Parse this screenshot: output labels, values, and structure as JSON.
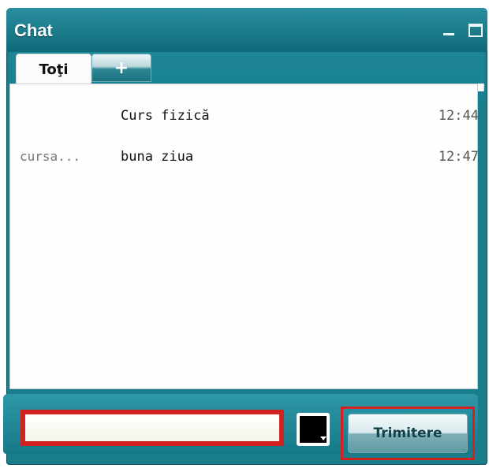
{
  "window": {
    "title": "Chat"
  },
  "tabs": [
    {
      "label": "Toţi",
      "active": true
    },
    {
      "label": "+"
    }
  ],
  "messages": [
    {
      "sender": "",
      "text": "Curs fizică",
      "time": "12:44"
    },
    {
      "sender": "cursa...",
      "text": "buna ziua",
      "time": "12:47"
    }
  ],
  "composer": {
    "input_value": "",
    "input_placeholder": "",
    "color": "#000000",
    "send_label": "Trimitere"
  },
  "highlight_color": "#d2221f"
}
